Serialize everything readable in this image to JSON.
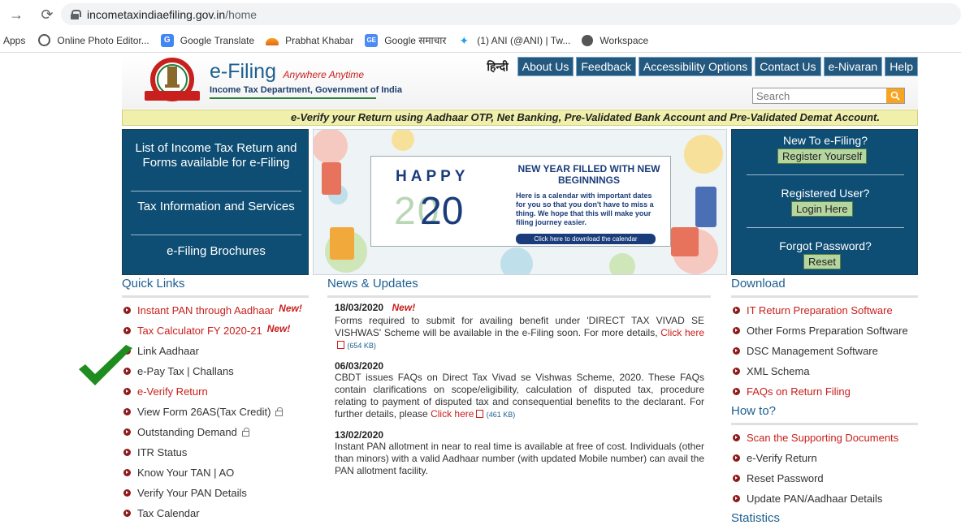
{
  "browser": {
    "url_domain": "incometaxindiaefiling.gov.in",
    "url_path": "/home",
    "bookmarks": [
      {
        "label": "Apps",
        "icon": "apps-grid-icon"
      },
      {
        "label": "Online Photo Editor...",
        "icon": "photo-editor-icon"
      },
      {
        "label": "Google Translate",
        "icon": "google-translate-icon"
      },
      {
        "label": "Prabhat Khabar",
        "icon": "prabhat-khabar-icon"
      },
      {
        "label": "Google समाचार",
        "icon": "google-news-icon"
      },
      {
        "label": "(1) ANI (@ANI) | Tw...",
        "icon": "twitter-icon"
      },
      {
        "label": "Workspace",
        "icon": "globe-icon"
      }
    ]
  },
  "header": {
    "title": "e-Filing",
    "tagline": "Anywhere Anytime",
    "subtitle": "Income Tax Department, Government of India",
    "hindi": "हिन्दी",
    "nav": [
      "About Us",
      "Feedback",
      "Accessibility Options",
      "Contact Us",
      "e-Nivaran",
      "Help"
    ],
    "search_placeholder": "Search"
  },
  "notice": "e-Verify your Return using Aadhaar OTP, Net Banking, Pre-Validated Bank Account and Pre-Validated Demat Account.",
  "left_box": {
    "items": [
      "List of Income Tax Return and Forms available for e-Filing",
      "Tax Information and Services",
      "e-Filing Brochures"
    ]
  },
  "banner": {
    "happy": "HAPPY",
    "year_ghost": "20",
    "year": "20",
    "heading": "NEW YEAR FILLED WITH NEW BEGINNINGS",
    "body": "Here is a calendar with important dates for you so that you don't have to miss a thing. We hope that this will make your filing journey easier.",
    "cta": "Click here to download the calendar"
  },
  "right_box": {
    "new_title": "New To e-Filing?",
    "register": "Register Yourself",
    "registered_title": "Registered User?",
    "login": "Login Here",
    "forgot_title": "Forgot Password?",
    "reset": "Reset"
  },
  "quick_links": {
    "heading": "Quick Links",
    "new_label": "New!",
    "items": [
      {
        "label": "Instant PAN through Aadhaar",
        "red": true,
        "new": true
      },
      {
        "label": "Tax Calculator FY 2020-21",
        "red": true,
        "new": true
      },
      {
        "label": "Link Aadhaar"
      },
      {
        "label": "e-Pay Tax | Challans"
      },
      {
        "label": "e-Verify Return",
        "red": true
      },
      {
        "label": "View Form 26AS(Tax Credit)",
        "lock": true
      },
      {
        "label": "Outstanding Demand",
        "lock": true
      },
      {
        "label": "ITR Status"
      },
      {
        "label": "Know Your TAN | AO"
      },
      {
        "label": "Verify Your PAN Details"
      },
      {
        "label": "Tax Calendar"
      }
    ]
  },
  "news": {
    "heading": "News & Updates",
    "items": [
      {
        "date": "18/03/2020",
        "new": "New!",
        "text": "Forms required to submit for availing benefit under 'DIRECT TAX VIVAD SE VISHWAS' Scheme will be available in the e-Filing soon. For more details, ",
        "link": "Click here",
        "size": "(654 KB)"
      },
      {
        "date": "06/03/2020",
        "text": "CBDT issues FAQs on Direct Tax Vivad se Vishwas Scheme, 2020. These FAQs contain clarifications on scope/eligibility, calculation of disputed tax, procedure relating to payment of disputed tax and consequential benefits to the declarant. For further details, please ",
        "link": "Click here",
        "size": "(461 KB)"
      },
      {
        "date": "13/02/2020",
        "text": "Instant PAN allotment in near to real time is available at free of cost. Individuals (other than minors) with a valid Aadhaar number (with updated Mobile number) can avail the PAN allotment facility."
      }
    ]
  },
  "download": {
    "heading": "Download",
    "items": [
      {
        "label": "IT Return Preparation Software",
        "red": true
      },
      {
        "label": "Other Forms Preparation Software"
      },
      {
        "label": "DSC Management Software"
      },
      {
        "label": "XML Schema"
      },
      {
        "label": "FAQs on Return Filing",
        "red": true
      }
    ]
  },
  "howto": {
    "heading": "How to?",
    "items": [
      {
        "label": "Scan the Supporting Documents",
        "red": true
      },
      {
        "label": "e-Verify Return"
      },
      {
        "label": "Reset Password"
      },
      {
        "label": "Update PAN/Aadhaar Details"
      }
    ]
  },
  "statistics": {
    "heading": "Statistics"
  },
  "colors": {
    "accent": "#0f4e74",
    "link_red": "#c8201d",
    "notice_bg": "#f0f0ac",
    "check_green": "#1e8c1e"
  }
}
